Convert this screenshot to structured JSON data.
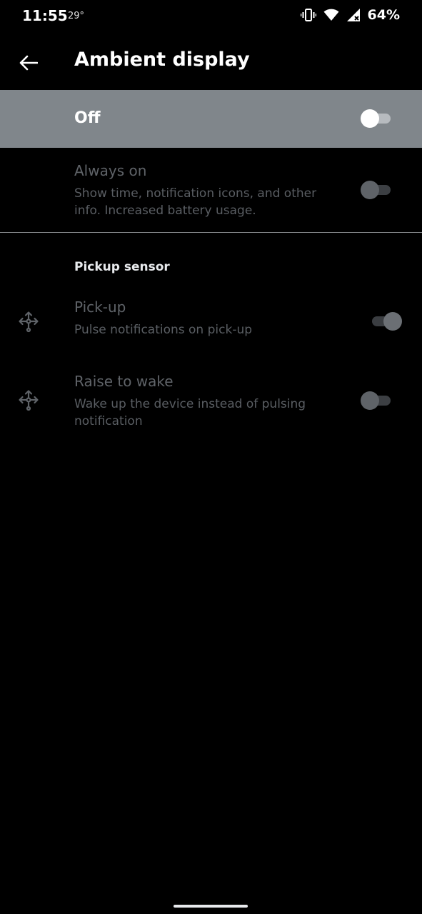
{
  "status_bar": {
    "time": "11:55",
    "temperature": "29°",
    "battery": "64%"
  },
  "app_bar": {
    "title": "Ambient display"
  },
  "master_switch": {
    "label": "Off",
    "checked": false
  },
  "always_on": {
    "title": "Always on",
    "summary": "Show time, notification icons, and other info. Increased battery usage.",
    "checked": false
  },
  "pickup_sensor": {
    "header": "Pickup sensor",
    "items": [
      {
        "title": "Pick-up",
        "summary": "Pulse notifications on pick-up",
        "icon": "move-gesture-icon",
        "checked": true
      },
      {
        "title": "Raise to wake",
        "summary": "Wake up the device instead of pulsing notification",
        "icon": "move-gesture-icon",
        "checked": false
      }
    ]
  },
  "colors": {
    "background": "#000000",
    "master_bar": "#80868b",
    "disabled_text": "#5f6368"
  }
}
